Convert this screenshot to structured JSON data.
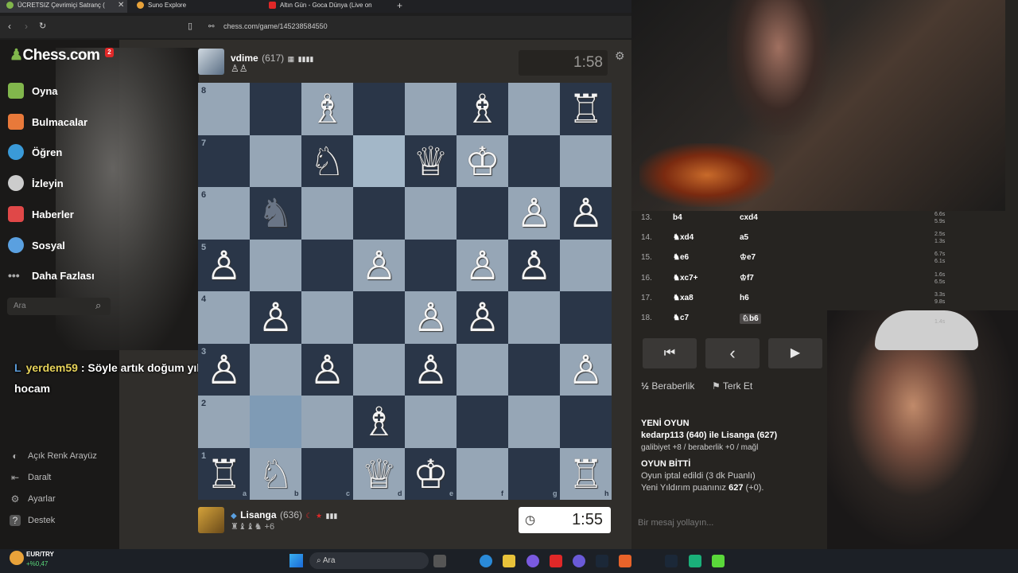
{
  "browser": {
    "tabs": [
      {
        "label": "ÜCRETSIZ Çevrimiçi Satranç (",
        "color": "#81b64c"
      },
      {
        "label": "Suno Explore",
        "color": "#e8a23a"
      },
      {
        "label": "Altın Gün - Goca Dünya (Live on",
        "color": "#e02828"
      }
    ],
    "url": "chess.com/game/145238584550",
    "add_tab": "+"
  },
  "sidebar": {
    "logo": "Chess.com",
    "notification_count": "2",
    "items": [
      {
        "label": "Oyna",
        "color": "#81b64c"
      },
      {
        "label": "Bulmacalar",
        "color": "#e8793a"
      },
      {
        "label": "Öğren",
        "color": "#3a9ad8"
      },
      {
        "label": "İzleyin",
        "color": "#cccccc"
      },
      {
        "label": "Haberler",
        "color": "#e04848"
      },
      {
        "label": "Sosyal",
        "color": "#5aa0e0"
      },
      {
        "label": "Daha Fazlası",
        "color": "#aaaaaa"
      }
    ],
    "search_placeholder": "Ara",
    "bottom": [
      {
        "label": "Açık Renk Arayüz",
        "icon": "◐"
      },
      {
        "label": "Daralt",
        "icon": "⇤"
      },
      {
        "label": "Ayarlar",
        "icon": "⚙"
      },
      {
        "label": "Destek",
        "icon": "?"
      }
    ]
  },
  "chat": {
    "initial": "L",
    "user": "yerdem59",
    "message": " : Söyle artık doğum yılını hocam"
  },
  "top_player": {
    "name": "vdime",
    "rating": "(617)",
    "clock": "1:58"
  },
  "bottom_player": {
    "name": "Lisanga",
    "rating": "(636)",
    "captured_extra": "+6",
    "clock": "1:55"
  },
  "board": {
    "ranks": [
      "8",
      "7",
      "6",
      "5",
      "4",
      "3",
      "2",
      "1"
    ],
    "files": [
      "a",
      "b",
      "c",
      "d",
      "e",
      "f",
      "g",
      "h"
    ]
  },
  "moves": [
    {
      "no": "13.",
      "white": "b4",
      "black": "cxd4",
      "tw": "6.6s",
      "tb": "5.9s"
    },
    {
      "no": "14.",
      "white": "♞xd4",
      "black": "a5",
      "tw": "2.5s",
      "tb": "1.3s"
    },
    {
      "no": "15.",
      "white": "♞e6",
      "black": "♔e7",
      "tw": "6.7s",
      "tb": "6.1s"
    },
    {
      "no": "16.",
      "white": "♞xc7+",
      "black": "♔f7",
      "tw": "1.6s",
      "tb": "6.5s"
    },
    {
      "no": "17.",
      "white": "♞xa8",
      "black": "h6",
      "tw": "3.3s",
      "tb": "9.8s"
    },
    {
      "no": "18.",
      "white": "♞c7",
      "black": "♘b6",
      "tw": "",
      "tb": "1.4s"
    }
  ],
  "controls": {
    "first": "⏮",
    "prev": "‹",
    "next": "▶",
    "draw": "Beraberlik",
    "draw_icon": "½",
    "resign": "Terk Et"
  },
  "feed": {
    "new_game_title": "YENİ OYUN",
    "new_game_players": "kedarp113 (640) ile Lisanga (627)",
    "new_game_stakes": "galibiyet +8 / beraberlik +0 / mağl",
    "over_title": "OYUN BİTTİ",
    "over_line1": "Oyun iptal edildi (3 dk Puanlı)",
    "over_line2_pre": "Yeni Yıldırım puanınız ",
    "over_line2_val": "627",
    "over_line2_post": " (+0)."
  },
  "message_placeholder": "Bir mesaj yollayın...",
  "taskbar": {
    "ticker_label": "EUR/TRY",
    "ticker_change": "+%0,47",
    "search_label": "Ara"
  }
}
